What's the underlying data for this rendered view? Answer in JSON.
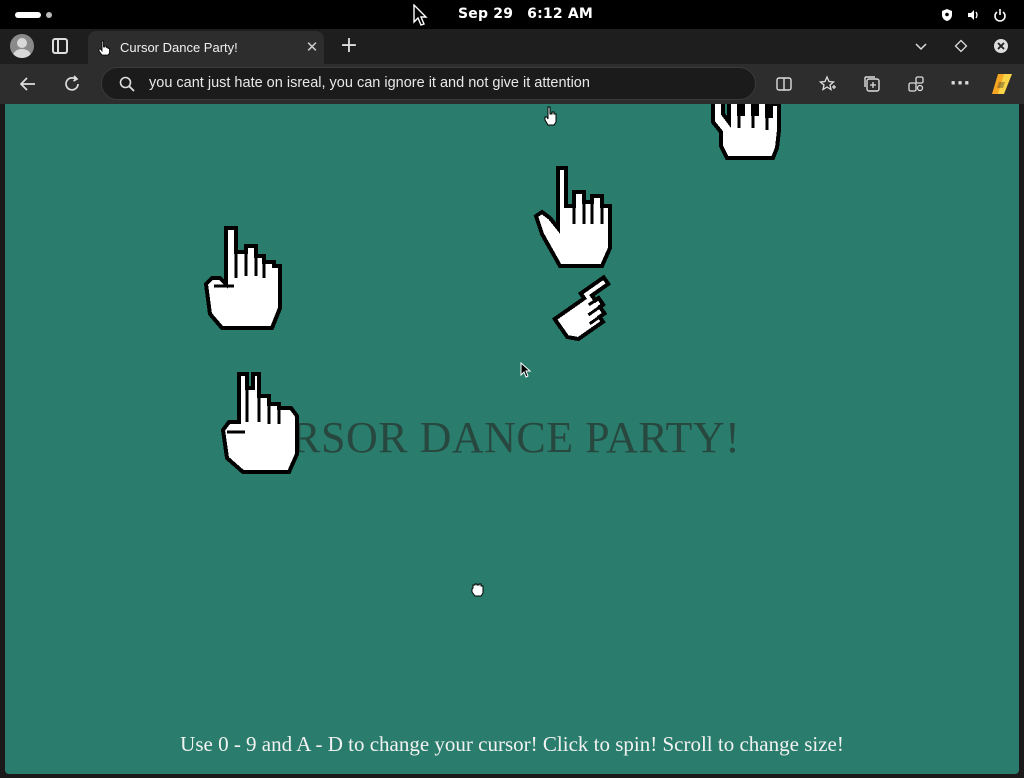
{
  "system": {
    "date": "Sep 29",
    "time": "6:12 AM"
  },
  "tab": {
    "title": "Cursor Dance Party!",
    "close_label": "✕"
  },
  "newtab_label": "+",
  "address": {
    "text": "you cant just hate on isreal, you can ignore it and not give it attention"
  },
  "toolbar": {
    "more_label": "···"
  },
  "page": {
    "title": "CURSOR DANCE PARTY!",
    "instructions": "Use 0 - 9 and A - D to change your cursor! Click to spin! Scroll to change size!"
  },
  "colors": {
    "page_bg": "#2a7d6c",
    "title_color": "#27473f",
    "chrome_dark": "#2d2d2d"
  },
  "icons": [
    "profile-icon",
    "tabs-icon",
    "hand-cursor-icon",
    "close-icon",
    "plus-icon",
    "chevron-down-icon",
    "workspace-icon",
    "window-close-icon",
    "back-icon",
    "refresh-icon",
    "search-icon",
    "split-screen-icon",
    "favorites-icon",
    "collections-icon",
    "extensions-icon",
    "more-icon",
    "copilot-icon",
    "pointer-cursor-icon",
    "pointing-hand-icon"
  ]
}
